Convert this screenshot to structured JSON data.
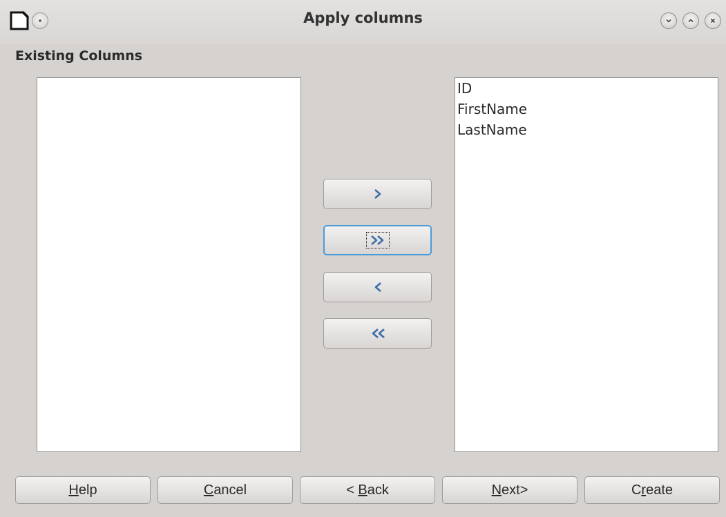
{
  "window": {
    "title": "Apply columns",
    "controls": [
      "minimize-icon",
      "maximize-icon",
      "close-icon"
    ]
  },
  "section": {
    "label": "Existing Columns"
  },
  "available_list": {
    "items": []
  },
  "selected_list": {
    "items": [
      "ID",
      "FirstName",
      "LastName"
    ]
  },
  "move_buttons": [
    {
      "icon": "chevron-right-icon",
      "label": ">"
    },
    {
      "icon": "double-chevron-right-icon",
      "label": ">>"
    },
    {
      "icon": "chevron-left-icon",
      "label": "<"
    },
    {
      "icon": "double-chevron-left-icon",
      "label": "<<"
    }
  ],
  "footer": {
    "help": {
      "pre": "",
      "mnemonic": "H",
      "post": "elp"
    },
    "cancel": {
      "pre": "",
      "mnemonic": "C",
      "post": "ancel"
    },
    "back": {
      "pre": "< ",
      "mnemonic": "B",
      "post": "ack"
    },
    "next": {
      "pre": "",
      "mnemonic": "N",
      "post": "ext>"
    },
    "create": {
      "pre": "C",
      "mnemonic": "r",
      "post": "eate"
    }
  },
  "colors": {
    "focus_accent": "#4a9bd8",
    "chevron": "#3d6ea8"
  }
}
